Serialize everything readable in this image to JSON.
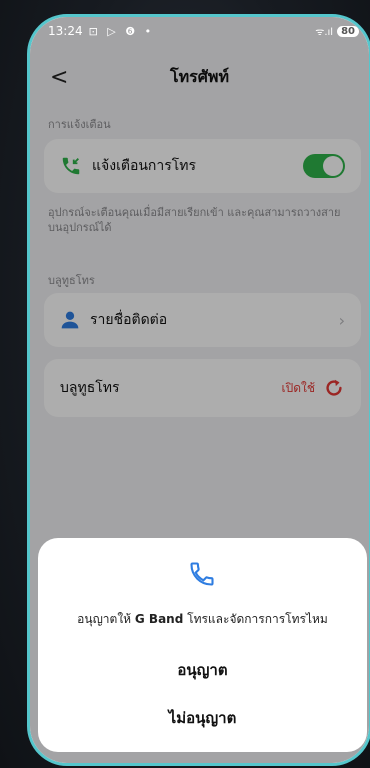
{
  "status": {
    "time": "13:24",
    "icons_left": "⊡ ▷ ❻ •",
    "signal": "ᯤ.ıl",
    "battery": "80"
  },
  "header": {
    "back": "<",
    "title": "โทรศัพท์"
  },
  "notification": {
    "section_label": "การแจ้งเตือน",
    "item_label": "แจ้งเตือนการโทร",
    "toggle_on": true,
    "description": "อุปกรณ์จะเตือนคุณเมื่อมีสายเรียกเข้า และคุณสามารถวางสายบนอุปกรณ์ได้"
  },
  "bluetooth": {
    "section_label": "บลูทูธโทร",
    "contacts_label": "รายชื่อติดต่อ",
    "row_label": "บลูทูธโทร",
    "enable_label": "เปิดใช้"
  },
  "dialog": {
    "message_pre": "อนุญาตให้ ",
    "app_name": "G Band",
    "message_post": " โทรและจัดการการโทรไหม",
    "allow": "อนุญาต",
    "deny": "ไม่อนุญาต"
  },
  "colors": {
    "accent_green": "#2fb34a",
    "accent_blue": "#2f7de1",
    "accent_red": "#e53935",
    "frame": "#55c6cc"
  }
}
